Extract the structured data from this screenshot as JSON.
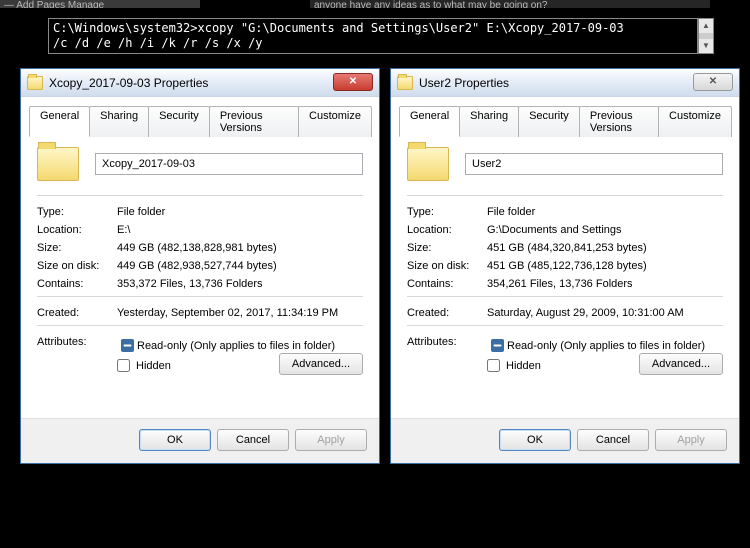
{
  "background": {
    "strip1": "— Add Pages   Manage",
    "strip2": "anyone have any ideas as to what may be going on?"
  },
  "cmd": {
    "text": "C:\\Windows\\system32>xcopy \"G:\\Documents and Settings\\User2\" E:\\Xcopy_2017-09-03\n/c /d /e /h /i /k /r /s /x /y"
  },
  "dialogs": [
    {
      "title": "Xcopy_2017-09-03 Properties",
      "close_style": "red",
      "tabs": [
        "General",
        "Sharing",
        "Security",
        "Previous Versions",
        "Customize"
      ],
      "name": "Xcopy_2017-09-03",
      "type": "File folder",
      "location": "E:\\",
      "size": "449 GB (482,138,828,981 bytes)",
      "size_on_disk": "449 GB (482,938,527,744 bytes)",
      "contains": "353,372 Files, 13,736 Folders",
      "created": "Yesterday, September 02, 2017, 11:34:19 PM",
      "labels": {
        "type": "Type:",
        "location": "Location:",
        "size": "Size:",
        "sod": "Size on disk:",
        "contains": "Contains:",
        "created": "Created:",
        "attributes": "Attributes:",
        "readonly": "Read-only (Only applies to files in folder)",
        "hidden": "Hidden",
        "advanced": "Advanced...",
        "ok": "OK",
        "cancel": "Cancel",
        "apply": "Apply"
      }
    },
    {
      "title": "User2 Properties",
      "close_style": "grey",
      "tabs": [
        "General",
        "Sharing",
        "Security",
        "Previous Versions",
        "Customize"
      ],
      "name": "User2",
      "type": "File folder",
      "location": "G:\\Documents and Settings",
      "size": "451 GB (484,320,841,253 bytes)",
      "size_on_disk": "451 GB (485,122,736,128 bytes)",
      "contains": "354,261 Files, 13,736 Folders",
      "created": "Saturday, August 29, 2009, 10:31:00 AM",
      "labels": {
        "type": "Type:",
        "location": "Location:",
        "size": "Size:",
        "sod": "Size on disk:",
        "contains": "Contains:",
        "created": "Created:",
        "attributes": "Attributes:",
        "readonly": "Read-only (Only applies to files in folder)",
        "hidden": "Hidden",
        "advanced": "Advanced...",
        "ok": "OK",
        "cancel": "Cancel",
        "apply": "Apply"
      }
    }
  ]
}
